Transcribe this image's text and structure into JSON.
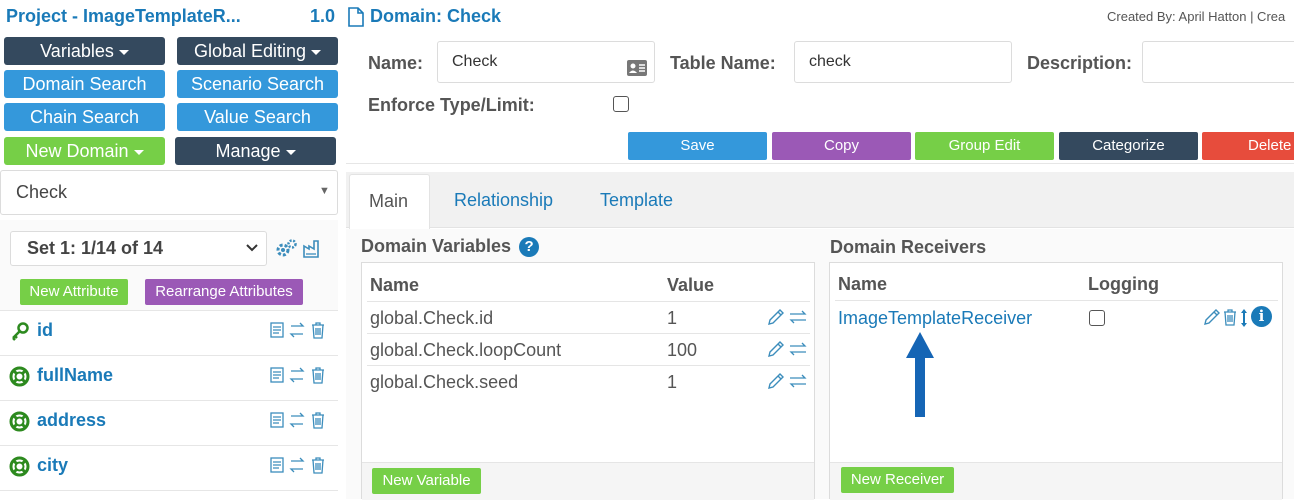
{
  "header": {
    "project_title": "Project - ImageTemplateR...",
    "version": "1.0",
    "domain_title": "Domain: Check",
    "created_by": "Created By: April Hatton | Crea"
  },
  "sidebar": {
    "buttons": {
      "variables": "Variables",
      "global_editing": "Global Editing",
      "domain_search": "Domain Search",
      "scenario_search": "Scenario Search",
      "chain_search": "Chain Search",
      "value_search": "Value Search",
      "new_domain": "New Domain",
      "manage": "Manage"
    },
    "domain_select": "Check",
    "set_select": "Set 1: 1/14 of 14",
    "new_attribute": "New Attribute",
    "rearrange_attributes": "Rearrange Attributes",
    "attributes": [
      {
        "name": "id",
        "icon": "key-icon"
      },
      {
        "name": "fullName",
        "icon": "lifebuoy-icon"
      },
      {
        "name": "address",
        "icon": "lifebuoy-icon"
      },
      {
        "name": "city",
        "icon": "lifebuoy-icon"
      }
    ]
  },
  "form": {
    "name_label": "Name:",
    "name_value": "Check",
    "table_name_label": "Table Name:",
    "table_name_value": "check",
    "description_label": "Description:",
    "description_value": "",
    "enforce_label": "Enforce Type/Limit:",
    "enforce_checked": false
  },
  "actions": {
    "save": "Save",
    "copy": "Copy",
    "group_edit": "Group Edit",
    "categorize": "Categorize",
    "delete": "Delete"
  },
  "tabs": [
    {
      "label": "Main",
      "active": true
    },
    {
      "label": "Relationship",
      "active": false
    },
    {
      "label": "Template",
      "active": false
    }
  ],
  "domain_variables": {
    "title": "Domain Variables",
    "col_name": "Name",
    "col_value": "Value",
    "rows": [
      {
        "name": "global.Check.id",
        "value": "1"
      },
      {
        "name": "global.Check.loopCount",
        "value": "100"
      },
      {
        "name": "global.Check.seed",
        "value": "1"
      }
    ],
    "new_button": "New Variable"
  },
  "domain_receivers": {
    "title": "Domain Receivers",
    "col_name": "Name",
    "col_logging": "Logging",
    "rows": [
      {
        "name": "ImageTemplateReceiver",
        "logging": false
      }
    ],
    "new_button": "New Receiver"
  },
  "colors": {
    "dark": "#34495e",
    "blue": "#3498db",
    "green": "#76cf47",
    "purple": "#9b59b6",
    "red": "#e74c3c",
    "link": "#1a7ab8",
    "annotation_arrow": "#1565b5"
  }
}
